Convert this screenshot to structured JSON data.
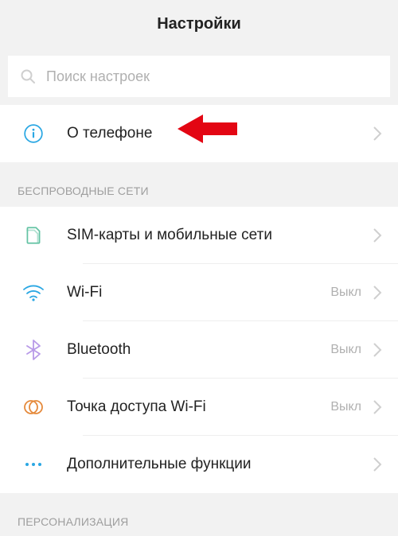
{
  "header": {
    "title": "Настройки"
  },
  "search": {
    "placeholder": "Поиск настроек"
  },
  "sections": {
    "about": {
      "label": "О телефоне"
    },
    "wireless": {
      "title": "БЕСПРОВОДНЫЕ СЕТИ",
      "sim": {
        "label": "SIM-карты и мобильные сети"
      },
      "wifi": {
        "label": "Wi-Fi",
        "status": "Выкл"
      },
      "bt": {
        "label": "Bluetooth",
        "status": "Выкл"
      },
      "hotspot": {
        "label": "Точка доступа Wi-Fi",
        "status": "Выкл"
      },
      "more": {
        "label": "Дополнительные функции"
      }
    },
    "personalization": {
      "title": "ПЕРСОНАЛИЗАЦИЯ"
    }
  }
}
